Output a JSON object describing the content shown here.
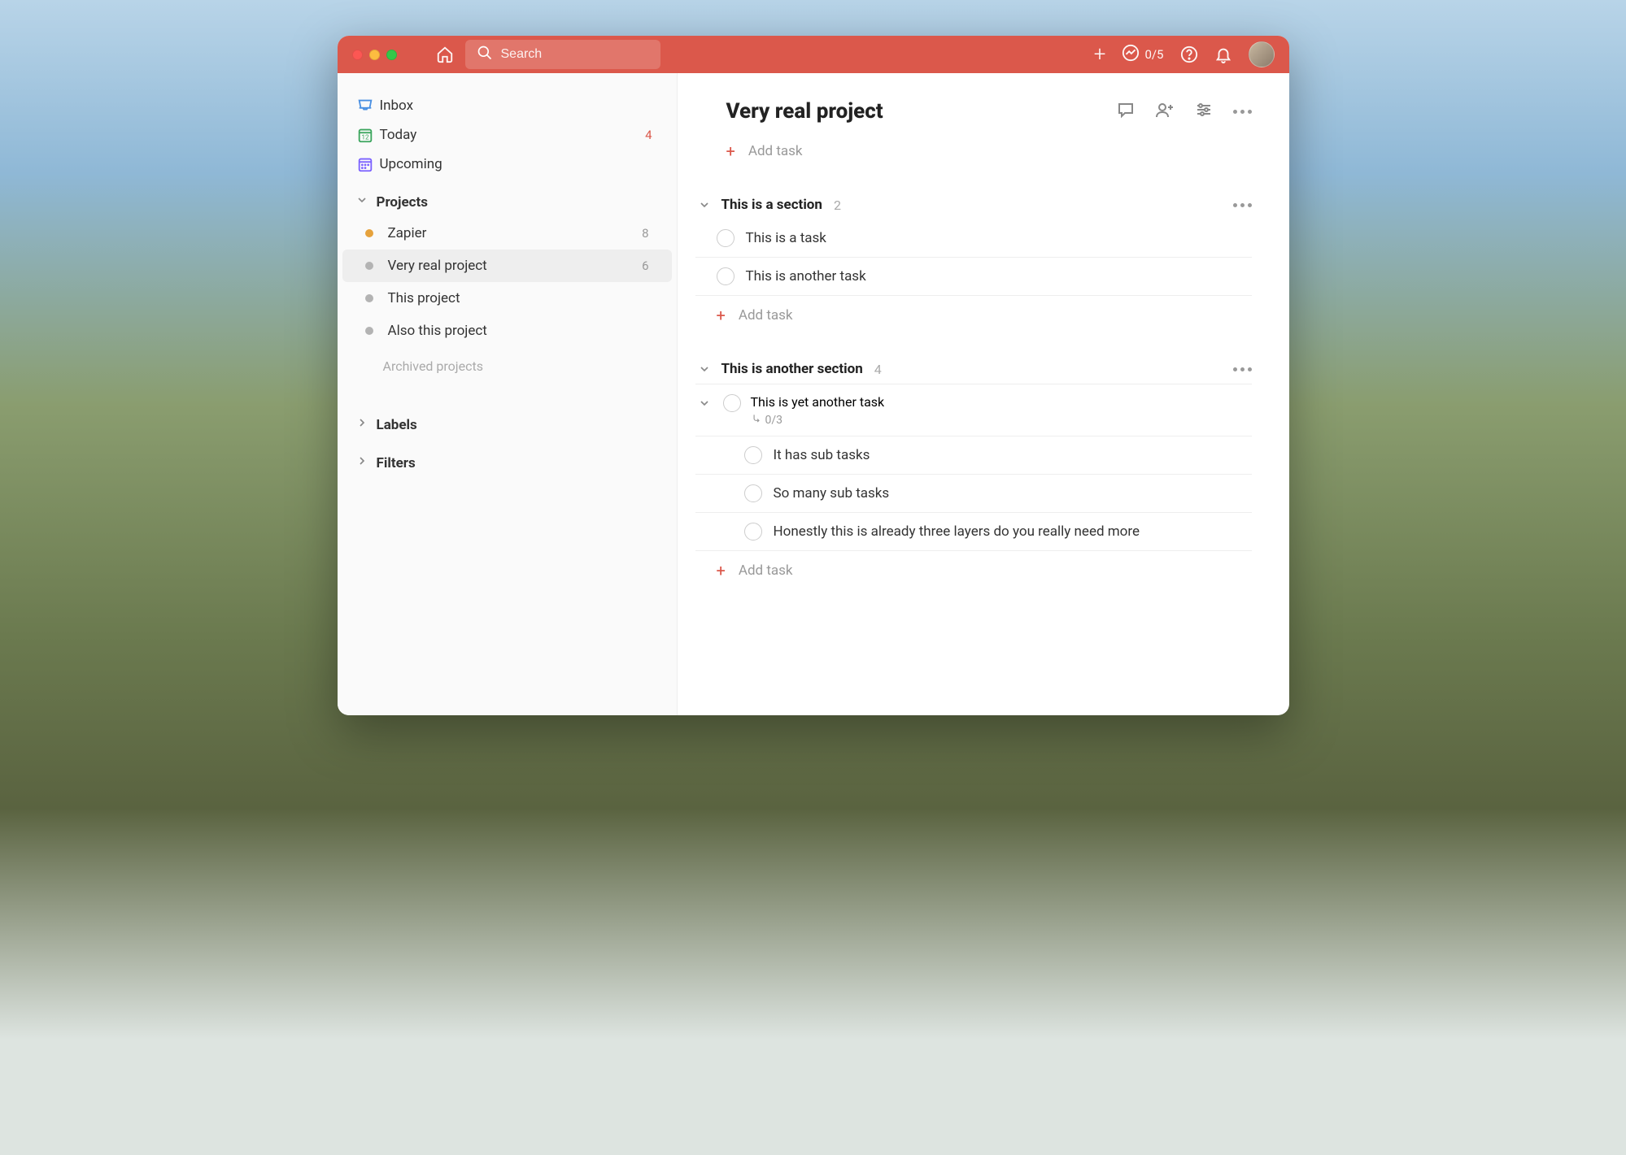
{
  "colors": {
    "accent": "#DB584B",
    "project_orange": "#E6A23C",
    "project_grey": "#b3b3b3"
  },
  "titlebar": {
    "search_placeholder": "Search",
    "progress": "0/5"
  },
  "sidebar": {
    "inbox": "Inbox",
    "today": "Today",
    "today_count": "4",
    "upcoming": "Upcoming",
    "projects_header": "Projects",
    "projects": [
      {
        "name": "Zapier",
        "count": "8",
        "color": "#E6A23C",
        "active": false
      },
      {
        "name": "Very real project",
        "count": "6",
        "color": "#b3b3b3",
        "active": true
      },
      {
        "name": "This project",
        "count": "",
        "color": "#b3b3b3",
        "active": false
      },
      {
        "name": "Also this project",
        "count": "",
        "color": "#b3b3b3",
        "active": false
      }
    ],
    "archived": "Archived projects",
    "labels": "Labels",
    "filters": "Filters"
  },
  "main": {
    "title": "Very real project",
    "add_task": "Add task",
    "sections": [
      {
        "name": "This is a section",
        "count": "2",
        "tasks": [
          {
            "title": "This is a task"
          },
          {
            "title": "This is another task"
          }
        ]
      },
      {
        "name": "This is another section",
        "count": "4",
        "parent_task": {
          "title": "This is yet another task",
          "subtask_progress": "0/3",
          "subtasks": [
            {
              "title": "It has sub tasks"
            },
            {
              "title": "So many sub tasks"
            },
            {
              "title": "Honestly this is already three layers do you really need more"
            }
          ]
        }
      }
    ]
  }
}
